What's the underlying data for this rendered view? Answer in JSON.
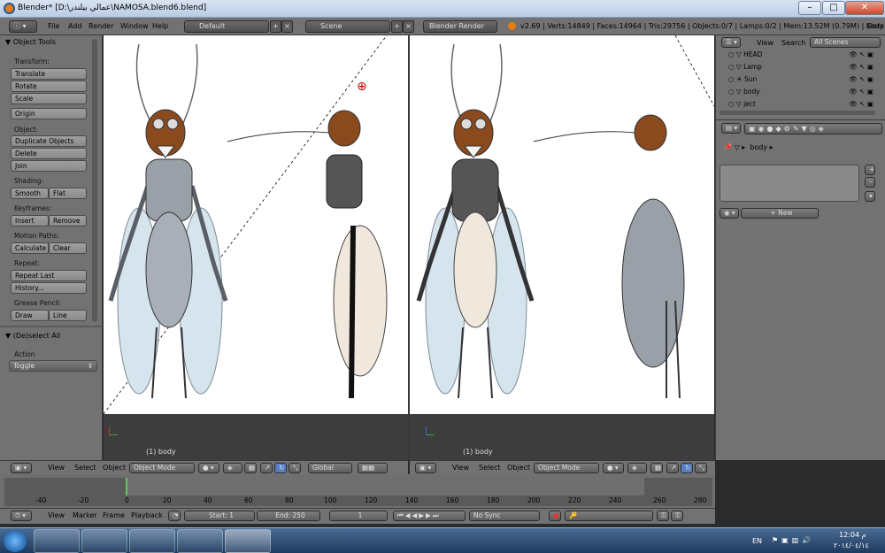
{
  "window": {
    "title": "Blender* [D:\\عمالي بيلندر\\NAMOSA.blend6.blend]",
    "minimize": "–",
    "maximize": "□",
    "close": "✕"
  },
  "infobar": {
    "menus": [
      "File",
      "Add",
      "Render",
      "Window",
      "Help"
    ],
    "layout": "Default",
    "scene": "Scene",
    "engine": "Blender Render",
    "stats": "v2.69 | Verts:14849 | Faces:14964 | Tris:29756 | Objects:0/7 | Lamps:0/2 | Mem:13.52M (0.79M) | body",
    "right_label": "Dem"
  },
  "toolshelf": {
    "title": "Object Tools",
    "sections": [
      {
        "label": "Transform:",
        "buttons": [
          "Translate",
          "Rotate",
          "Scale"
        ]
      },
      {
        "label": "",
        "buttons": [
          "Origin"
        ]
      },
      {
        "label": "Object:",
        "buttons": [
          "Duplicate Objects",
          "Delete",
          "Join"
        ]
      },
      {
        "label": "Shading:",
        "pair": [
          "Smooth",
          "Flat"
        ]
      },
      {
        "label": "Keyframes:",
        "pair": [
          "Insert",
          "Remove"
        ]
      },
      {
        "label": "Motion Paths:",
        "pair": [
          "Calculate",
          "Clear"
        ]
      },
      {
        "label": "Repeat:",
        "buttons": [
          "Repeat Last",
          "History..."
        ]
      },
      {
        "label": "Grease Pencil:",
        "pair": [
          "Draw",
          "Line"
        ]
      }
    ],
    "operator_title": "(De)select All",
    "action_label": "Action",
    "action_value": "Toggle"
  },
  "viewports": {
    "left_label": "(1) body",
    "right_label": "(1) body"
  },
  "view_header": {
    "menus": [
      "View",
      "Select",
      "Object"
    ],
    "mode": "Object Mode",
    "orientation": "Global"
  },
  "outliner": {
    "menus": [
      "View",
      "Search"
    ],
    "scenes": "All Scenes",
    "rows": [
      "HEAD",
      "Lamp",
      "Sun",
      "body",
      "ject"
    ]
  },
  "properties": {
    "breadcrumb": "body",
    "new_button": "New"
  },
  "timeline": {
    "ticks": [
      "-40",
      "-20",
      "0",
      "20",
      "40",
      "60",
      "80",
      "100",
      "120",
      "140",
      "160",
      "180",
      "200",
      "220",
      "240",
      "260",
      "280"
    ],
    "menus": [
      "View",
      "Marker",
      "Frame",
      "Playback"
    ],
    "start": "Start: 1",
    "end": "End: 250",
    "current": "1",
    "sync": "No Sync"
  },
  "taskbar": {
    "lang": "EN",
    "time": "12:04 م",
    "date": "٢٠١٤/٠٤/١٤"
  },
  "colors": {
    "panel": "#727272",
    "viewport_bg": "#ffffff",
    "accent": "#5680c2",
    "current_frame": "#5ec85e"
  }
}
